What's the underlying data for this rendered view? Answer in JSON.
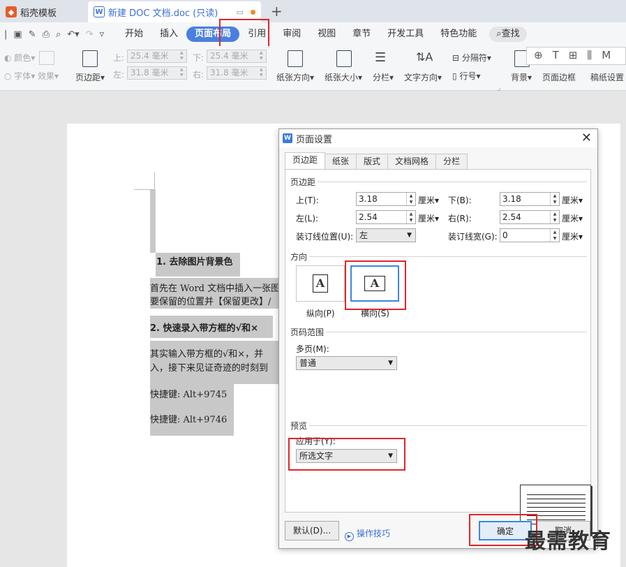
{
  "tabs": [
    {
      "label": "稻壳模板",
      "active": false
    },
    {
      "label": "新建 DOC 文档.doc (只读)",
      "active": true
    }
  ],
  "menu": {
    "items": [
      "开始",
      "插入",
      "页面布局",
      "引用",
      "审阅",
      "视图",
      "章节",
      "开发工具",
      "特色功能"
    ],
    "active": "页面布局",
    "search": "查找"
  },
  "ribbon": {
    "color": "颜色",
    "font": "字体",
    "effect": "效果",
    "margin": "页边距",
    "top_lbl": "上:",
    "top_val": "25.4 毫米",
    "bottom_lbl": "下:",
    "bottom_val": "25.4 毫米",
    "left_lbl": "左:",
    "left_val": "31.8 毫米",
    "right_lbl": "右:",
    "right_val": "31.8 毫米",
    "orientation": "纸张方向",
    "size": "纸张大小",
    "columns": "分栏",
    "text_direction": "文字方向",
    "separator": "分隔符",
    "line_number": "行号",
    "background": "背景",
    "page_border": "页面边框",
    "manuscript": "稿纸设置"
  },
  "document": {
    "h1": "1. 去除图片背景色",
    "p1a": "首先在 Word 文档中插入一张图",
    "p1b": "要保留的位置并【保留更改】/",
    "h2": "2. 快速录入带方框的√和×",
    "p2a": "其实输入带方框的√和×，并",
    "p2b": "入，接下来见证奇迹的时刻到",
    "k1": "快捷键: Alt+9745",
    "k2": "快捷键: Alt+9746"
  },
  "dialog": {
    "title": "页面设置",
    "tabs": [
      "页边距",
      "纸张",
      "版式",
      "文档网格",
      "分栏"
    ],
    "active_tab": "页边距",
    "margins_section": "页边距",
    "top_label": "上(T):",
    "top_value": "3.18",
    "bottom_label": "下(B):",
    "bottom_value": "3.18",
    "left_label": "左(L):",
    "left_value": "2.54",
    "right_label": "右(R):",
    "right_value": "2.54",
    "unit": "厘米",
    "gutter_pos_label": "装订线位置(U):",
    "gutter_pos_value": "左",
    "gutter_width_label": "装订线宽(G):",
    "gutter_width_value": "0",
    "orientation_section": "方向",
    "portrait": "纵向(P)",
    "landscape": "横向(S)",
    "orientation_selected": "landscape",
    "pages_section": "页码范围",
    "multiple_pages_label": "多页(M):",
    "multiple_pages_value": "普通",
    "preview_section": "预览",
    "apply_to_label": "应用于(Y):",
    "apply_to_value": "所选文字",
    "default_btn": "默认(D)...",
    "tips": "操作技巧",
    "ok_btn": "确定",
    "cancel_btn": "取消"
  },
  "watermark": "最需教育",
  "colors": {
    "accent": "#4a7fe0",
    "highlight": "#e0262a",
    "selection": "#c8c8c8"
  }
}
